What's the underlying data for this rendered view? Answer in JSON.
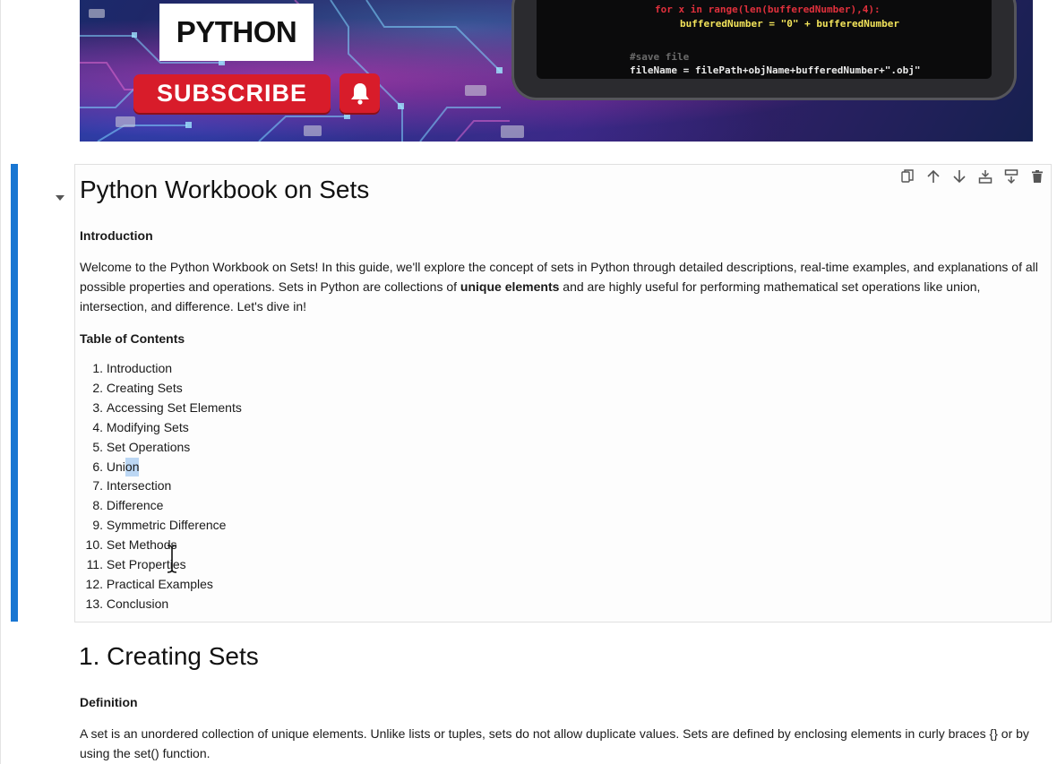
{
  "banner": {
    "logo_text": "PYTHON",
    "subscribe_label": "SUBSCRIBE",
    "code": {
      "line1": "for x in range(len(bufferedNumber),4):",
      "line2": "bufferedNumber = \"0\" + bufferedNumber",
      "line3": "#save file",
      "line4": "fileName = filePath+objName+bufferedNumber+\".obj\""
    }
  },
  "toolbar": {
    "icons": [
      "copy-icon",
      "arrow-up-icon",
      "arrow-down-icon",
      "insert-above-icon",
      "insert-below-icon",
      "trash-icon"
    ]
  },
  "cell": {
    "title": "Python Workbook on Sets",
    "intro_heading": "Introduction",
    "intro_p1": "Welcome to the Python Workbook on Sets! In this guide, we'll explore the concept of sets in Python through detailed descriptions, real-time examples, and explanations of all possible properties and operations. Sets in Python are collections of ",
    "intro_bold": "unique elements",
    "intro_p2": " and are highly useful for performing mathematical set operations like union, intersection, and difference. Let's dive in!",
    "toc_heading": "Table of Contents",
    "toc": [
      {
        "num": "1.",
        "text": "Introduction"
      },
      {
        "num": "2.",
        "text": "Creating Sets"
      },
      {
        "num": "3.",
        "text": "Accessing Set Elements"
      },
      {
        "num": "4.",
        "text": "Modifying Sets"
      },
      {
        "num": "5.",
        "text": "Set Operations"
      },
      {
        "num": "6.",
        "text_a": "Uni",
        "text_hl": "on"
      },
      {
        "num": "7.",
        "text": "Intersection"
      },
      {
        "num": "8.",
        "text": "Difference"
      },
      {
        "num": "9.",
        "text": "Symmetric Difference"
      },
      {
        "num": "10.",
        "text": "Set Methods"
      },
      {
        "num": "11.",
        "text": "Set Properties"
      },
      {
        "num": "12.",
        "text": "Practical Examples"
      },
      {
        "num": "13.",
        "text": "Conclusion"
      }
    ]
  },
  "section1": {
    "title": "1. Creating Sets",
    "definition_heading": "Definition",
    "definition_text": "A set is an unordered collection of unique elements. Unlike lists or tuples, sets do not allow duplicate values. Sets are defined by enclosing elements in curly braces {} or by using the set() function."
  }
}
